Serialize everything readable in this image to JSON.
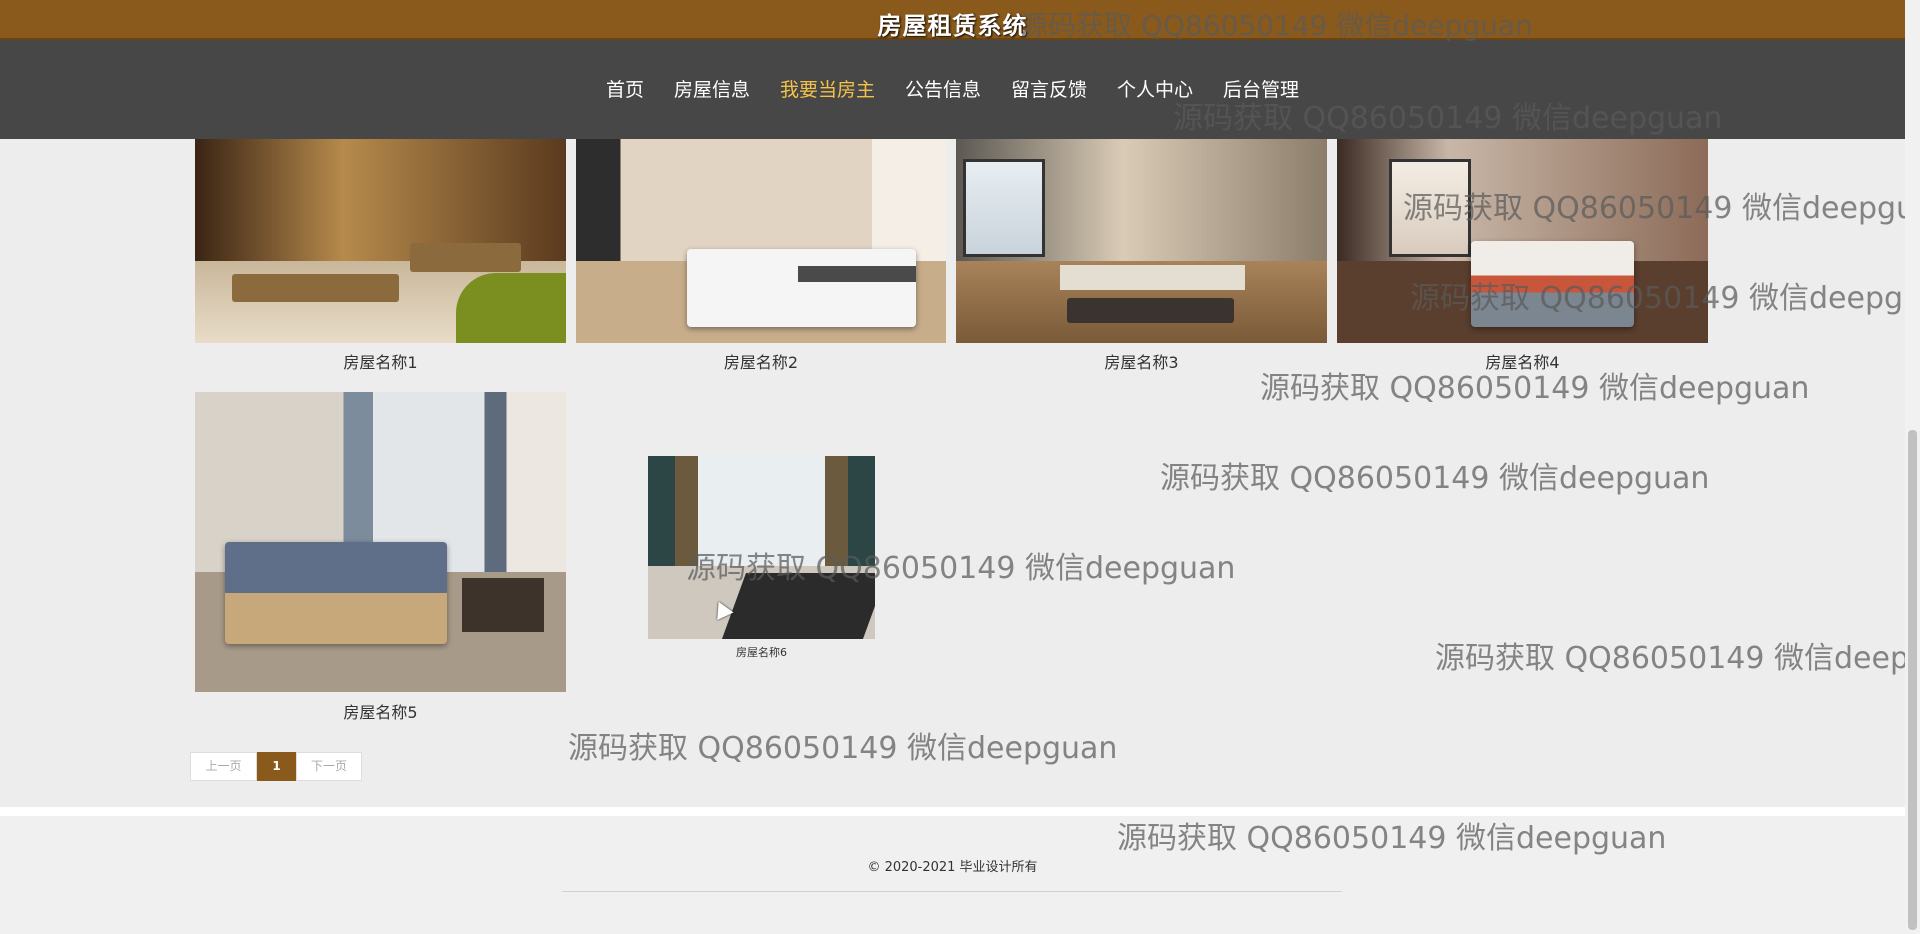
{
  "header": {
    "title": "房屋租赁系统"
  },
  "nav": {
    "items": [
      {
        "label": "首页"
      },
      {
        "label": "房屋信息"
      },
      {
        "label": "我要当房主"
      },
      {
        "label": "公告信息"
      },
      {
        "label": "留言反馈"
      },
      {
        "label": "个人中心"
      },
      {
        "label": "后台管理"
      }
    ],
    "active_index": 2
  },
  "listings": [
    {
      "name": "房屋名称1",
      "image": "dining-room"
    },
    {
      "name": "房屋名称2",
      "image": "bedroom"
    },
    {
      "name": "房屋名称3",
      "image": "living-room"
    },
    {
      "name": "房屋名称4",
      "image": "bedroom"
    },
    {
      "name": "房屋名称5",
      "image": "bedroom"
    },
    {
      "name": "房屋名称6",
      "image": "bedroom-window"
    }
  ],
  "pager": {
    "prev": "上一页",
    "current": "1",
    "next": "下一页"
  },
  "footer": {
    "copyright": "© 2020-2021 毕业设计所有"
  },
  "watermark": {
    "text": "源码获取 QQ86050149 微信deepguan"
  },
  "colors": {
    "brand": "#8a5a1c",
    "nav_bg": "#474747",
    "nav_active": "#f3c24a"
  }
}
